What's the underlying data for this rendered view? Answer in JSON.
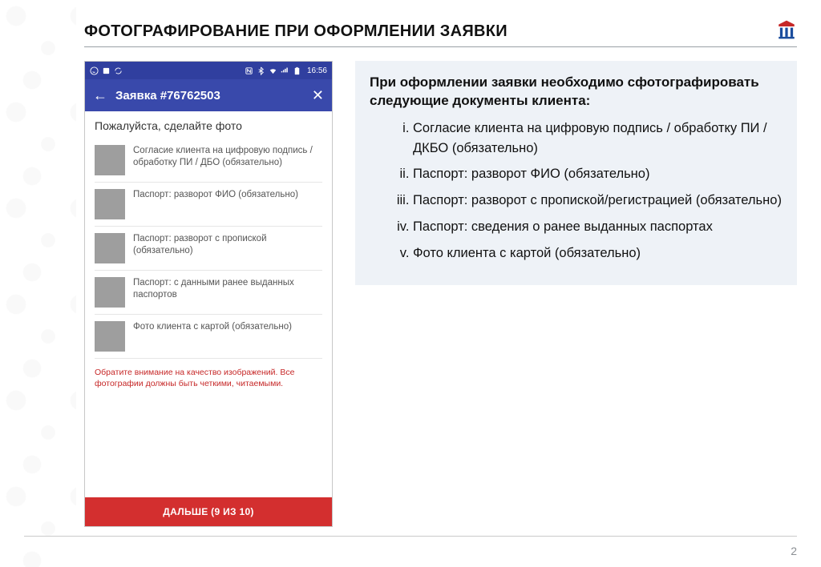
{
  "header": {
    "title": "ФОТОГРАФИРОВАНИЕ ПРИ ОФОРМЛЕНИИ ЗАЯВКИ"
  },
  "phone": {
    "status": {
      "time": "16:56"
    },
    "appbar": {
      "title": "Заявка #76762503"
    },
    "prompt": "Пожалуйста, сделайте фото",
    "items": [
      "Согласие клиента на цифровую подпись / обработку ПИ / ДБО (обязательно)",
      "Паспорт: разворот ФИО (обязательно)",
      "Паспорт: разворот с пропиской (обязательно)",
      "Паспорт: с данными ранее выданных паспортов",
      "Фото клиента с картой (обязательно)"
    ],
    "warning": "Обратите внимание на качество изображений. Все фотографии должны быть четкими, читаемыми.",
    "next": "ДАЛЬШЕ (9 ИЗ 10)"
  },
  "info": {
    "lead": "При оформлении заявки необходимо сфотографировать следующие документы клиента:",
    "items": [
      "Согласие клиента на цифровую подпись / обработку ПИ / ДКБО (обязательно)",
      "Паспорт: разворот ФИО (обязательно)",
      "Паспорт: разворот с пропиской/регистрацией (обязательно)",
      "Паспорт: сведения о ранее выданных паспортах",
      "Фото клиента с картой (обязательно)"
    ]
  },
  "page_number": "2"
}
